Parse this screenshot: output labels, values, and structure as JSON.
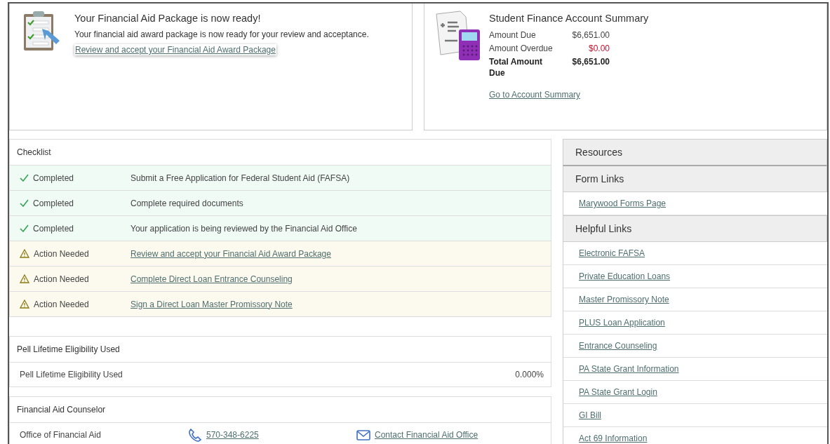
{
  "aid_package": {
    "title": "Your Financial Aid Package is now ready!",
    "message": "Your financial aid award package is now ready for your review and acceptance.",
    "link": "Review and accept your Financial Aid Award Package"
  },
  "account_summary": {
    "title": "Student Finance Account Summary",
    "rows": [
      {
        "label": "Amount Due",
        "value": "$6,651.00",
        "kind": "normal"
      },
      {
        "label": "Amount Overdue",
        "value": "$0.00",
        "kind": "overdue"
      },
      {
        "label": "Total Amount Due",
        "value": "$6,651.00",
        "kind": "total"
      }
    ],
    "link": "Go to Account Summary"
  },
  "checklist": {
    "title": "Checklist",
    "items": [
      {
        "kind": "completed",
        "status": "Completed",
        "task": "Submit a Free Application for Federal Student Aid (FAFSA)"
      },
      {
        "kind": "completed",
        "status": "Completed",
        "task": "Complete required documents"
      },
      {
        "kind": "completed",
        "status": "Completed",
        "task": "Your application is being reviewed by the Financial Aid Office"
      },
      {
        "kind": "action",
        "status": "Action Needed",
        "task": "Review and accept your Financial Aid Award Package"
      },
      {
        "kind": "action",
        "status": "Action Needed",
        "task": "Complete Direct Loan Entrance Counseling"
      },
      {
        "kind": "action",
        "status": "Action Needed",
        "task": "Sign a Direct Loan Master Promissory Note"
      }
    ]
  },
  "pell": {
    "title": "Pell Lifetime Eligibility Used",
    "label": "Pell Lifetime Eligibility Used",
    "value": "0.000%"
  },
  "counselor": {
    "title": "Financial Aid Counselor",
    "name": "Office of Financial Aid",
    "phone": "570-348-6225",
    "email": "Contact Financial Aid Office"
  },
  "resources": {
    "title": "Resources",
    "sections": [
      {
        "title": "Form Links",
        "links": [
          "Marywood Forms Page"
        ]
      },
      {
        "title": "Helpful Links",
        "links": [
          "Electronic FAFSA",
          "Private Education Loans",
          "Master Promissory Note",
          "PLUS Loan Application",
          "Entrance Counseling",
          "PA State Grant Information",
          "PA State Grant Login",
          "GI Bill",
          "Act 69 Information"
        ]
      }
    ]
  }
}
